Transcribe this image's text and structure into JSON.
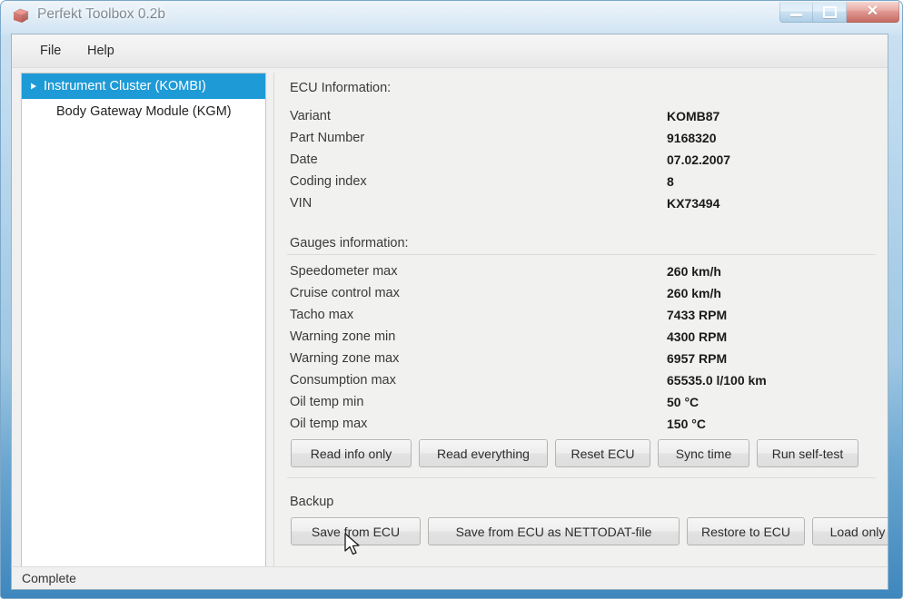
{
  "window": {
    "title": "Perfekt Toolbox 0.2b",
    "icon": "red-cube-icon",
    "controls": {
      "minimize": "–",
      "maximize": "□",
      "close": "✕"
    },
    "accent_color": "#1e9bd7",
    "close_color": "#c2392c"
  },
  "menubar": {
    "items": [
      {
        "label": "File"
      },
      {
        "label": "Help"
      }
    ]
  },
  "tree": {
    "items": [
      {
        "label": "Instrument Cluster (KOMBI)",
        "selected": true,
        "expanded": true
      },
      {
        "label": "Body Gateway Module (KGM)",
        "selected": false,
        "expanded": false
      }
    ]
  },
  "detail": {
    "ecu_section": {
      "heading": "ECU Information:",
      "rows": [
        {
          "label": "Variant",
          "value": "KOMB87"
        },
        {
          "label": "Part Number",
          "value": "9168320"
        },
        {
          "label": "Date",
          "value": "07.02.2007"
        },
        {
          "label": "Coding index",
          "value": "8"
        },
        {
          "label": "VIN",
          "value": "KX73494"
        }
      ]
    },
    "gauges_section": {
      "heading": "Gauges information:",
      "rows": [
        {
          "label": "Speedometer max",
          "value": "260 km/h"
        },
        {
          "label": "Cruise control max",
          "value": "260 km/h"
        },
        {
          "label": "Tacho max",
          "value": "7433 RPM"
        },
        {
          "label": "Warning zone min",
          "value": "4300 RPM"
        },
        {
          "label": "Warning zone max",
          "value": "6957 RPM"
        },
        {
          "label": "Consumption max",
          "value": "65535.0 l/100 km"
        },
        {
          "label": "Oil temp min",
          "value": "50 °C"
        },
        {
          "label": "Oil temp max",
          "value": "150 °C"
        }
      ]
    },
    "action_buttons": [
      {
        "label": "Read info only"
      },
      {
        "label": "Read everything"
      },
      {
        "label": "Reset ECU"
      },
      {
        "label": "Sync time"
      },
      {
        "label": "Run self-test"
      }
    ],
    "backup_section": {
      "heading": "Backup",
      "buttons": [
        {
          "label": "Save from ECU"
        },
        {
          "label": "Save from ECU as NETTODAT-file"
        },
        {
          "label": "Restore to ECU"
        },
        {
          "label": "Load only"
        }
      ]
    }
  },
  "statusbar": {
    "text": "Complete"
  }
}
